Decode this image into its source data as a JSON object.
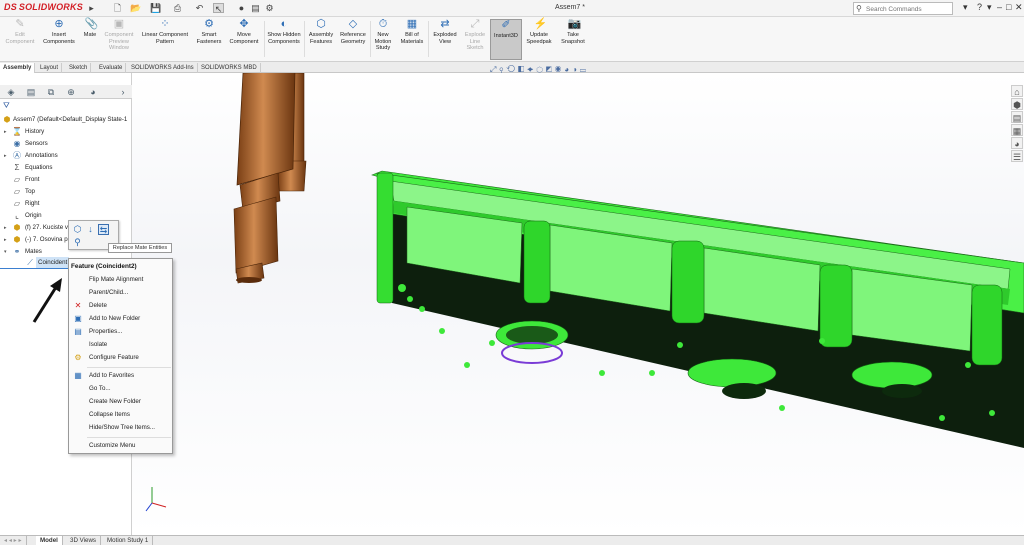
{
  "app": {
    "logo": "SOLIDWORKS",
    "title": "Assem7 *"
  },
  "search": {
    "placeholder": "Search Commands"
  },
  "commands": [
    {
      "label": "Edit Component",
      "enabled": false
    },
    {
      "label": "Insert Components",
      "enabled": true
    },
    {
      "label": "Mate",
      "enabled": true
    },
    {
      "label": "Component Preview Window",
      "enabled": false
    },
    {
      "label": "Linear Component Pattern",
      "enabled": true
    },
    {
      "label": "Smart Fasteners",
      "enabled": true
    },
    {
      "label": "Move Component",
      "enabled": true
    },
    {
      "label": "Show Hidden Components",
      "enabled": true
    },
    {
      "label": "Assembly Features",
      "enabled": true
    },
    {
      "label": "Reference Geometry",
      "enabled": true
    },
    {
      "label": "New Motion Study",
      "enabled": true
    },
    {
      "label": "Bill of Materials",
      "enabled": true
    },
    {
      "label": "Exploded View",
      "enabled": true
    },
    {
      "label": "Explode Line Sketch",
      "enabled": false
    },
    {
      "label": "Instant3D",
      "enabled": true,
      "active": true
    },
    {
      "label": "Update Speedpak",
      "enabled": true
    },
    {
      "label": "Take Snapshot",
      "enabled": true
    }
  ],
  "tabs": [
    "Assembly",
    "Layout",
    "Sketch",
    "Evaluate",
    "SOLIDWORKS Add-Ins",
    "SOLIDWORKS MBD"
  ],
  "tree": {
    "root": "Assem7 (Default<Default_Display State-1",
    "items": [
      "History",
      "Sensors",
      "Annotations",
      "Equations",
      "Front",
      "Top",
      "Right",
      "Origin",
      "(f) 27. Kuciste v",
      "(-) 7. Osovina p",
      "Mates",
      "Coincident"
    ]
  },
  "context_toolbar": {
    "tooltip": "Replace Mate Entities"
  },
  "menu": {
    "title": "Feature (Coincident2)",
    "items": [
      "Flip Mate Alignment",
      "Parent/Child...",
      "Delete",
      "Add to New Folder",
      "Properties...",
      "Isolate",
      "Configure Feature",
      "Add to Favorites",
      "Go To...",
      "Create New Folder",
      "Collapse Items",
      "Hide/Show Tree Items...",
      "Customize Menu"
    ]
  },
  "bottom_tabs": [
    "Model",
    "3D Views",
    "Motion Study 1"
  ],
  "colors": {
    "part_green": "#3ee83a",
    "part_dark": "#0a2a0a",
    "shaft": "#b8703a",
    "selection": "#7a3bd6"
  }
}
